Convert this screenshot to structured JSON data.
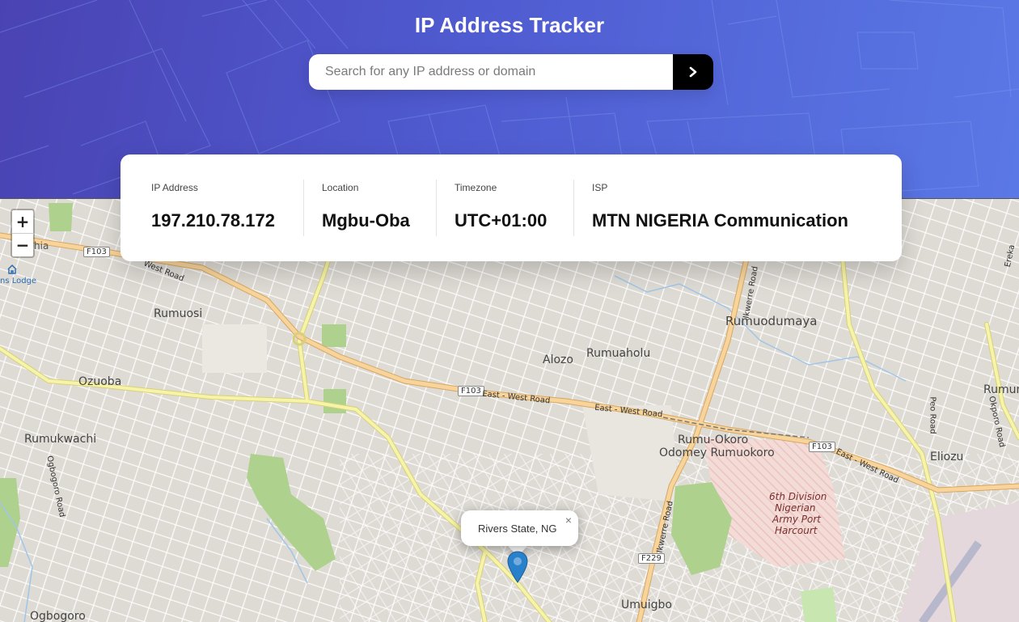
{
  "header": {
    "title": "IP Address Tracker"
  },
  "search": {
    "placeholder": "Search for any IP address or domain",
    "value": "",
    "button_icon": "chevron-right-icon"
  },
  "info": {
    "ip_label": "IP Address",
    "ip_value": "197.210.78.172",
    "location_label": "Location",
    "location_value": "Mgbu-Oba",
    "timezone_label": "Timezone",
    "timezone_value": "UTC+01:00",
    "isp_label": "ISP",
    "isp_value": "MTN NIGERIA Communication"
  },
  "map": {
    "zoom_in": "+",
    "zoom_out": "−",
    "popup_text": "Rivers State, NG",
    "popup_close": "×",
    "places": {
      "rumuosi": "Rumuosi",
      "ozuoba": "Ozuoba",
      "rumukwachi": "Rumukwachi",
      "alozo": "Alozo",
      "rumuaholu": "Rumuaholu",
      "rumuodumaya": "Rumuodumaya",
      "rumu_okoro": "Rumu-Okoro",
      "odomey": "Odomey Rumuokoro",
      "eliozu": "Eliozu",
      "umuigbo": "Umuigbo",
      "ogbogoro": "Ogbogoro",
      "rumun": "Rumun",
      "lodge": "ns Lodge",
      "hia": "hia",
      "army_1": "6th Division",
      "army_2": "Nigerian",
      "army_3": "Army Port",
      "army_4": "Harcourt"
    },
    "roads": {
      "f103": "F103",
      "f229": "F229",
      "ew_road": "East - West Road",
      "west_road": "West Road",
      "ikwerre": "Ikwerre Road",
      "okporo": "Okporo Road",
      "ogbogoro_rd": "Ogbogoro Road",
      "peo_road": "Peo Road",
      "ereka": "Ereka"
    },
    "colors": {
      "marker": "#2a81cb",
      "park": "#aed18e",
      "road_major": "#f8d49a",
      "road_secondary": "#f6f4a8"
    }
  }
}
